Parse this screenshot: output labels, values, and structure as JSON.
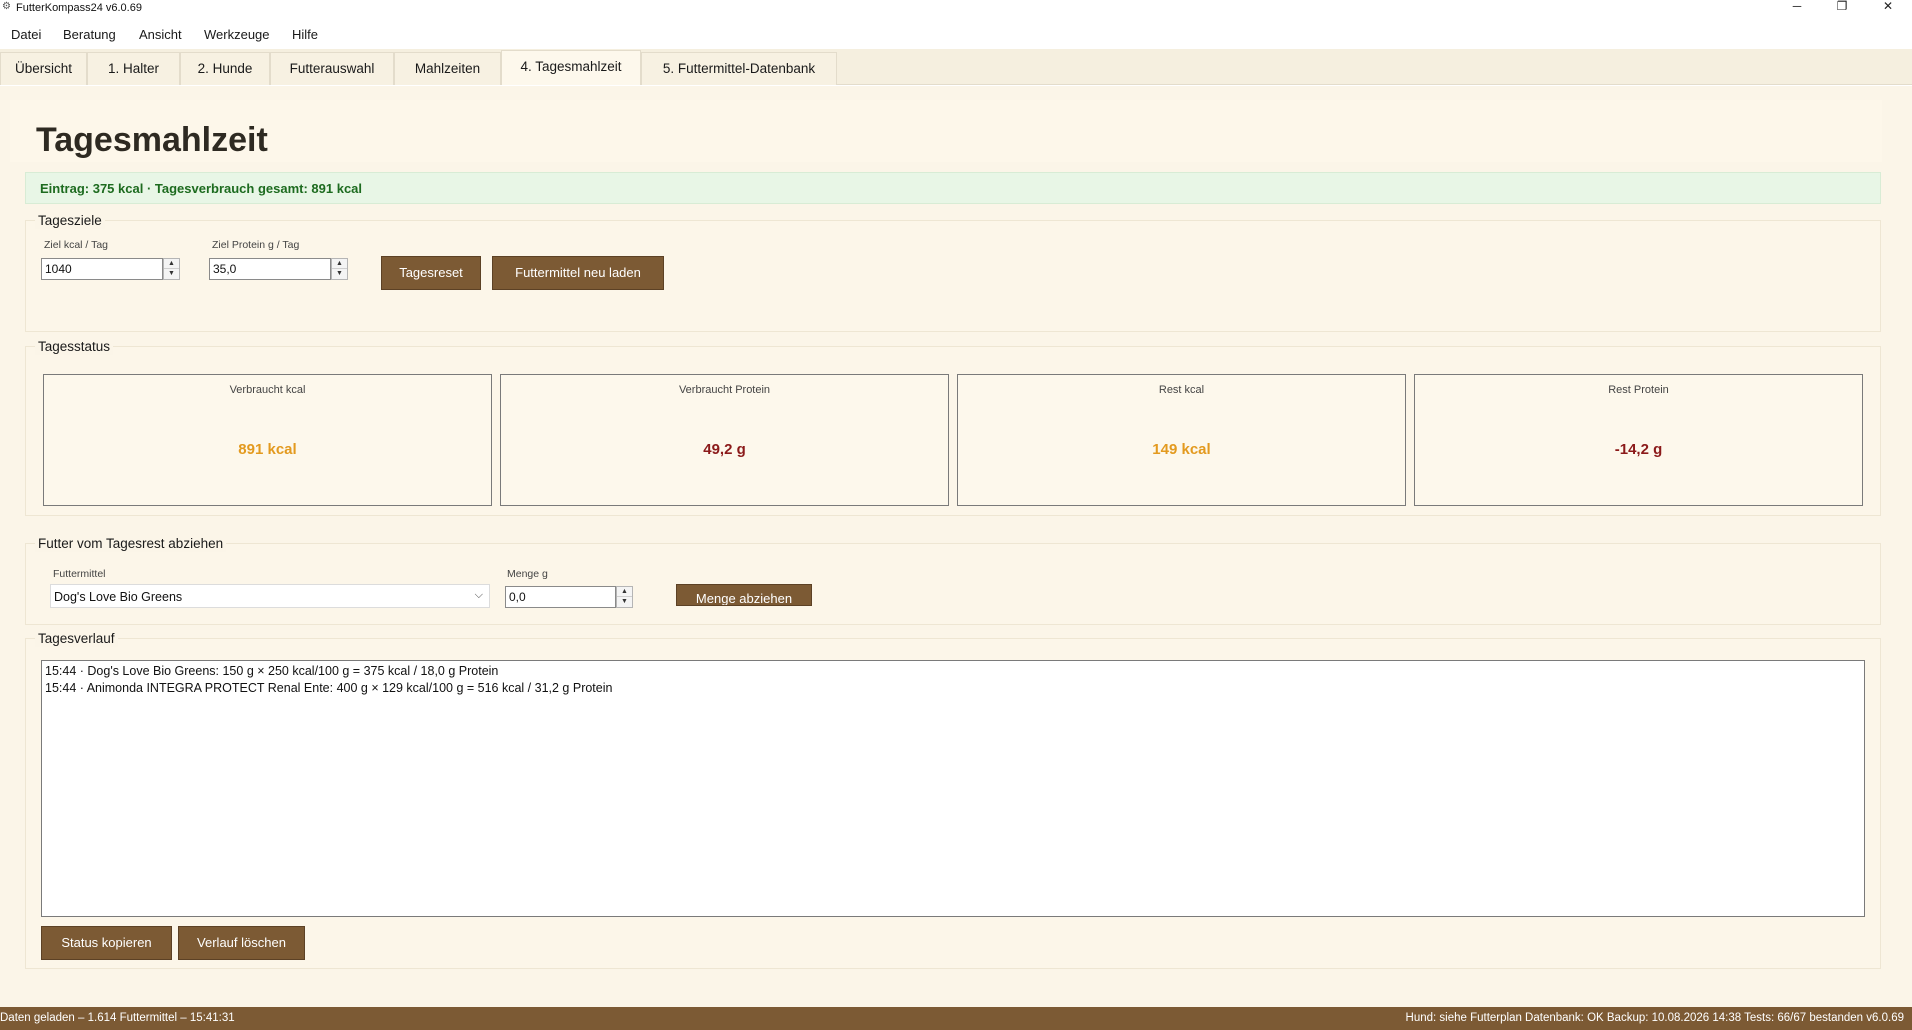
{
  "window": {
    "title": "FutterKompass24 v6.0.69",
    "minimize": "─",
    "maximize": "❐",
    "close": "✕"
  },
  "menu": [
    "Datei",
    "Beratung",
    "Ansicht",
    "Werkzeuge",
    "Hilfe"
  ],
  "tabs": [
    "Übersicht",
    "1. Halter",
    "2. Hunde",
    "Futterauswahl",
    "Mahlzeiten",
    "4. Tagesmahlzeit",
    "5. Futtermittel-Datenbank"
  ],
  "active_tab": "4. Tagesmahlzeit",
  "page": {
    "title": "Tagesmahlzeit",
    "banner": "Eintrag: 375 kcal · Tagesverbrauch gesamt: 891 kcal"
  },
  "tagesziele": {
    "title": "Tagesziele",
    "kcal_label": "Ziel kcal / Tag",
    "kcal_value": "1040",
    "protein_label": "Ziel Protein g / Tag",
    "protein_value": "35,0",
    "reset_button": "Tagesreset",
    "reload_button": "Futtermittel neu laden"
  },
  "tagesstatus": {
    "title": "Tagesstatus",
    "cards": [
      {
        "label": "Verbraucht kcal",
        "value": "891 kcal",
        "color": "#e39a1f"
      },
      {
        "label": "Verbraucht Protein",
        "value": "49,2 g",
        "color": "#8b1a1a"
      },
      {
        "label": "Rest kcal",
        "value": "149 kcal",
        "color": "#e39a1f"
      },
      {
        "label": "Rest Protein",
        "value": "-14,2 g",
        "color": "#8b1a1a"
      }
    ]
  },
  "abziehen": {
    "title": "Futter vom Tagesrest abziehen",
    "futtermittel_label": "Futtermittel",
    "futtermittel_value": "Dog's Love Bio Greens",
    "menge_label": "Menge g",
    "menge_value": "0,0",
    "button": "Menge abziehen"
  },
  "verlauf": {
    "title": "Tagesverlauf",
    "entries": [
      "15:44 · Dog's Love Bio Greens: 150 g × 250 kcal/100 g = 375 kcal / 18,0 g Protein",
      "15:44 · Animonda INTEGRA PROTECT Renal Ente: 400 g × 129 kcal/100 g = 516 kcal / 31,2 g Protein"
    ],
    "copy_button": "Status kopieren",
    "clear_button": "Verlauf löschen"
  },
  "statusbar": {
    "left": "Daten geladen – 1.614 Futtermittel – 15:41:31",
    "right": "Hund: siehe Futterplan   Datenbank: OK   Backup: 10.08.2026 14:38   Tests: 66/67 bestanden   v6.0.69"
  },
  "colors": {
    "accent_brown": "#7c5a34",
    "background_cream": "#fbf5e8",
    "banner_green": "#1d6b1f"
  }
}
